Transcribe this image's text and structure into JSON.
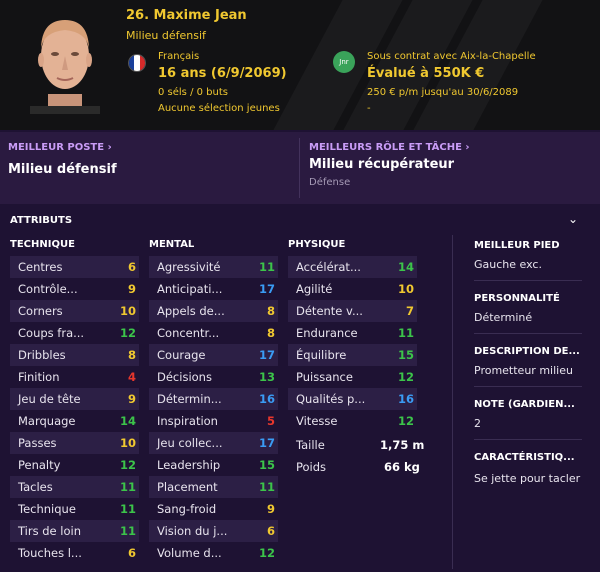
{
  "player": {
    "name": "26. Maxime Jean",
    "position": "Milieu défensif",
    "nationality": "Français",
    "age": "16 ans (6/9/2069)",
    "caps": "0 séls / 0 buts",
    "youth_caps": "Aucune sélection jeunes",
    "club_badge": "Jnr",
    "contract": "Sous contrat avec Aix-la-Chapelle",
    "value": "Évalué à 550K €",
    "wage": "250 € p/m jusqu'au 30/6/2089",
    "extra": "-"
  },
  "roles": {
    "best_position_label": "MEILLEUR POSTE",
    "best_position": "Milieu défensif",
    "best_role_label": "MEILLEURS RÔLE ET TÂCHE",
    "best_role": "Milieu récupérateur",
    "best_duty": "Défense"
  },
  "attributes": {
    "title": "ATTRIBUTS",
    "technique_head": "TECHNIQUE",
    "mental_head": "MENTAL",
    "physique_head": "PHYSIQUE",
    "technique": [
      {
        "label": "Centres",
        "value": "6"
      },
      {
        "label": "Contrôle...",
        "value": "9"
      },
      {
        "label": "Corners",
        "value": "10"
      },
      {
        "label": "Coups fra...",
        "value": "12"
      },
      {
        "label": "Dribbles",
        "value": "8"
      },
      {
        "label": "Finition",
        "value": "4"
      },
      {
        "label": "Jeu de tête",
        "value": "9"
      },
      {
        "label": "Marquage",
        "value": "14"
      },
      {
        "label": "Passes",
        "value": "10"
      },
      {
        "label": "Penalty",
        "value": "12"
      },
      {
        "label": "Tacles",
        "value": "11"
      },
      {
        "label": "Technique",
        "value": "11"
      },
      {
        "label": "Tirs de loin",
        "value": "11"
      },
      {
        "label": "Touches l...",
        "value": "6"
      }
    ],
    "mental": [
      {
        "label": "Agressivité",
        "value": "11"
      },
      {
        "label": "Anticipati...",
        "value": "17"
      },
      {
        "label": "Appels de...",
        "value": "8"
      },
      {
        "label": "Concentr...",
        "value": "8"
      },
      {
        "label": "Courage",
        "value": "17"
      },
      {
        "label": "Décisions",
        "value": "13"
      },
      {
        "label": "Détermin...",
        "value": "16"
      },
      {
        "label": "Inspiration",
        "value": "5"
      },
      {
        "label": "Jeu collec...",
        "value": "17"
      },
      {
        "label": "Leadership",
        "value": "15"
      },
      {
        "label": "Placement",
        "value": "11"
      },
      {
        "label": "Sang-froid",
        "value": "9"
      },
      {
        "label": "Vision du j...",
        "value": "6"
      },
      {
        "label": "Volume d...",
        "value": "12"
      }
    ],
    "physique": [
      {
        "label": "Accélérat...",
        "value": "14"
      },
      {
        "label": "Agilité",
        "value": "10"
      },
      {
        "label": "Détente v...",
        "value": "7"
      },
      {
        "label": "Endurance",
        "value": "11"
      },
      {
        "label": "Équilibre",
        "value": "15"
      },
      {
        "label": "Puissance",
        "value": "12"
      },
      {
        "label": "Qualités p...",
        "value": "16"
      },
      {
        "label": "Vitesse",
        "value": "12"
      }
    ],
    "height_label": "Taille",
    "height": "1,75 m",
    "weight_label": "Poids",
    "weight": "66 kg"
  },
  "side": {
    "foot_label": "MEILLEUR PIED",
    "foot": "Gauche exc.",
    "personality_label": "PERSONNALITÉ",
    "personality": "Déterminé",
    "description_label": "DESCRIPTION DE...",
    "description": "Prometteur milieu",
    "rating_label": "NOTE (GARDIEN...",
    "rating": "2",
    "traits_label": "CARACTÉRISTIQ...",
    "traits": "Se jette pour tacler"
  },
  "colors": {
    "header_text": "#f0c830",
    "value_low": "#e8372c",
    "value_mid": "#f0c830",
    "value_good": "#3cc44a",
    "value_high": "#3a9cf5"
  }
}
